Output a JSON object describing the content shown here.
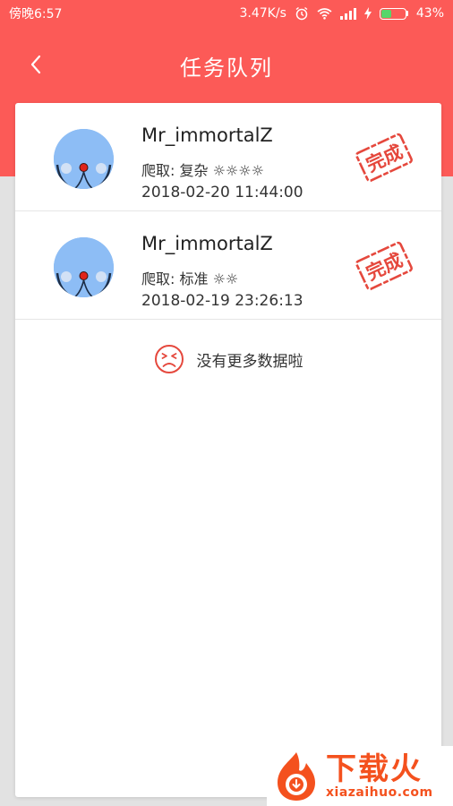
{
  "status_bar": {
    "time": "傍晚6:57",
    "network_speed": "3.47K/s",
    "battery_percent": "43%",
    "battery_level": 0.43,
    "icons": [
      "alarm-icon",
      "wifi-icon",
      "signal-icon",
      "charging-icon",
      "battery-icon"
    ]
  },
  "nav": {
    "back_icon": "chevron-left-icon",
    "title": "任务队列"
  },
  "tasks": [
    {
      "user": "Mr_immortalZ",
      "mode": "爬取: 复杂 ☼☼☼☼",
      "time": "2018-02-20 11:44:00",
      "stamp": "完成"
    },
    {
      "user": "Mr_immortalZ",
      "mode": "爬取: 标准 ☼☼",
      "time": "2018-02-19 23:26:13",
      "stamp": "完成"
    }
  ],
  "empty_message": "没有更多数据啦",
  "watermark": {
    "title": "下载火",
    "url": "xiazaihuo.com"
  },
  "colors": {
    "header": "#fc5a57",
    "background": "#e2e2e2",
    "stamp": "#e5483d",
    "watermark": "#f4511e"
  }
}
